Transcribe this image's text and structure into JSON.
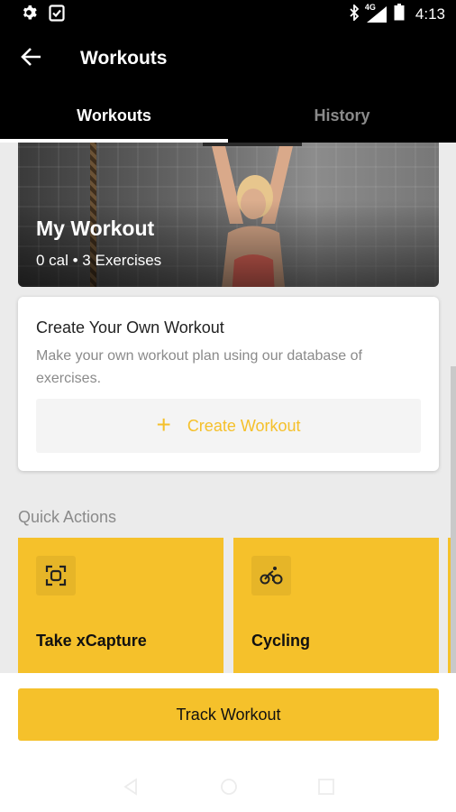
{
  "status_bar": {
    "time": "4:13",
    "network": "4G",
    "icons": [
      "settings-icon",
      "clipboard-check-icon",
      "bluetooth-icon",
      "signal-icon",
      "battery-icon"
    ]
  },
  "app_bar": {
    "title": "Workouts",
    "back_icon": "arrow-left-icon"
  },
  "tabs": [
    {
      "label": "Workouts",
      "active": true
    },
    {
      "label": "History",
      "active": false
    }
  ],
  "hero": {
    "title": "My Workout",
    "subtitle": "0 cal • 3 Exercises"
  },
  "create_card": {
    "title": "Create Your Own Workout",
    "description": "Make your own workout plan using our database of exercises.",
    "button_label": "Create Workout",
    "button_icon": "plus-icon"
  },
  "quick_actions": {
    "title": "Quick Actions",
    "items": [
      {
        "label": "Take xCapture",
        "icon": "scan-icon"
      },
      {
        "label": "Cycling",
        "icon": "bicycle-icon"
      }
    ]
  },
  "footer": {
    "track_label": "Track Workout"
  },
  "colors": {
    "accent": "#f5c12b",
    "app_bar": "#000000",
    "background": "#ebebeb"
  }
}
